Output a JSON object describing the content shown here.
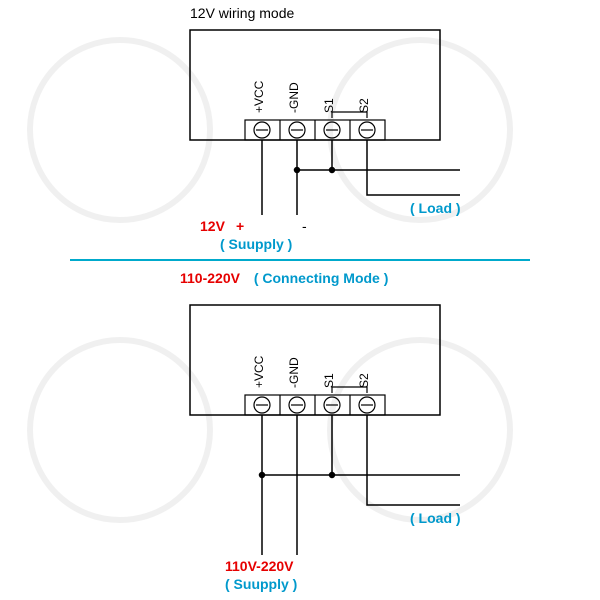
{
  "top": {
    "title": "12V wiring mode",
    "terminals": [
      "+VCC",
      "-GND",
      "S1",
      "S2"
    ],
    "supply_voltage": "12V",
    "supply_plus": "+",
    "supply_minus": "-",
    "supply_label": "( Suupply )",
    "load_label": "( Load )"
  },
  "bottom": {
    "title_voltage": "110-220V",
    "title_mode": "( Connecting  Mode )",
    "terminals": [
      "+VCC",
      "-GND",
      "S1",
      "S2"
    ],
    "supply_voltage": "110V-220V",
    "supply_label": "( Suupply )",
    "load_label": "( Load )"
  },
  "watermark_hint": "faint circular logo watermark"
}
